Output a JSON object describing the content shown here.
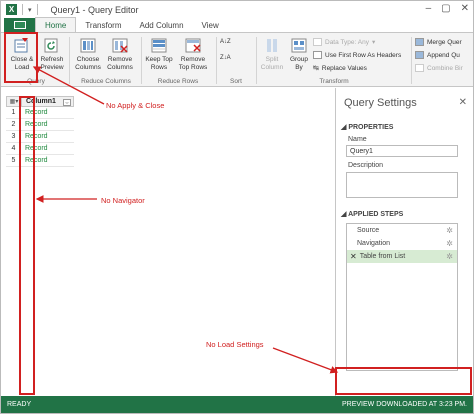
{
  "window": {
    "title": "Query1 - Query Editor",
    "logo": "X"
  },
  "tabs": [
    {
      "label": "Home",
      "active": true
    },
    {
      "label": "Transform",
      "active": false
    },
    {
      "label": "Add Column",
      "active": false
    },
    {
      "label": "View",
      "active": false
    }
  ],
  "ribbon": {
    "close_load": {
      "line1": "Close &",
      "line2": "Load"
    },
    "refresh": {
      "line1": "Refresh",
      "line2": "Preview"
    },
    "choose_columns": {
      "line1": "Choose",
      "line2": "Columns"
    },
    "remove_columns": {
      "line1": "Remove",
      "line2": "Columns"
    },
    "keep_top_rows": {
      "line1": "Keep Top",
      "line2": "Rows"
    },
    "remove_top_rows": {
      "line1": "Remove",
      "line2": "Top Rows"
    },
    "sort_asc": "A↓Z",
    "sort_desc": "Z↓A",
    "split_column": {
      "line1": "Split",
      "line2": "Column"
    },
    "group_by": {
      "line1": "Group",
      "line2": "By"
    },
    "data_type": "Data Type: Any",
    "use_first_row": "Use First Row As Headers",
    "replace_values": "Replace Values",
    "merge_queries": "Merge Quer",
    "append_queries": "Append Qu",
    "combine_binaries": "Combine Bir",
    "groups": {
      "query": "Query",
      "reduce_columns": "Reduce Columns",
      "reduce_rows": "Reduce Rows",
      "sort": "Sort",
      "transform": "Transform"
    }
  },
  "grid": {
    "column": "Column1",
    "rows": [
      {
        "n": "1",
        "v": "Record"
      },
      {
        "n": "2",
        "v": "Record"
      },
      {
        "n": "3",
        "v": "Record"
      },
      {
        "n": "4",
        "v": "Record"
      },
      {
        "n": "5",
        "v": "Record"
      }
    ]
  },
  "query_settings": {
    "title": "Query Settings",
    "properties": "PROPERTIES",
    "name_label": "Name",
    "name_value": "Query1",
    "description_label": "Description",
    "applied_steps": "APPLIED STEPS",
    "steps": [
      {
        "label": "Source"
      },
      {
        "label": "Navigation"
      },
      {
        "label": "Table from List"
      }
    ]
  },
  "status": {
    "left": "READY",
    "right": "PREVIEW DOWNLOADED AT 3:23 PM."
  },
  "annotations": {
    "apply_close": "No Apply & Close",
    "navigator": "No Navigator",
    "load_settings": "No Load Settings"
  },
  "colors": {
    "accent": "#217346",
    "annotation": "#d12020",
    "record": "#218a3f"
  }
}
